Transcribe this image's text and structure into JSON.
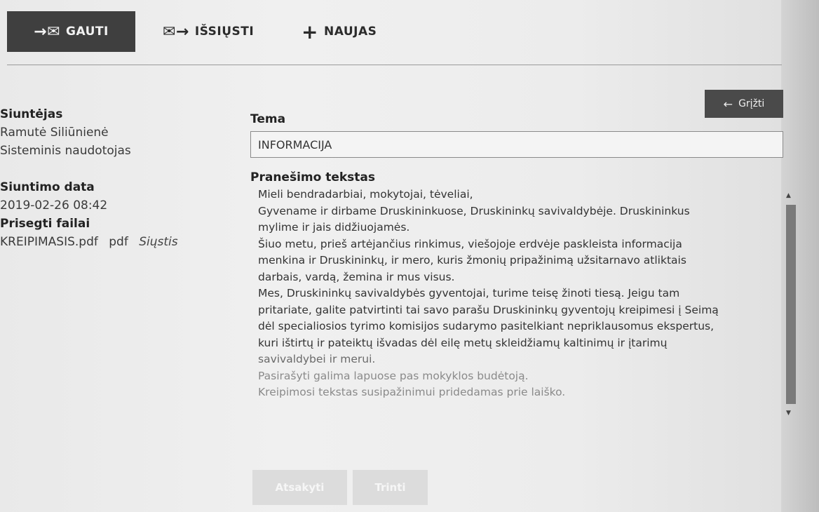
{
  "tabs": [
    {
      "icon": "→✉",
      "label": "GAUTI"
    },
    {
      "icon": "✉→",
      "label": "IŠSIŲSTI"
    },
    {
      "icon": "+",
      "label": "NAUJAS"
    }
  ],
  "sender": {
    "label": "Siuntėjas",
    "name": "Ramutė Siliūnienė",
    "role": "Sisteminis naudotojas"
  },
  "sent_date": {
    "label": "Siuntimo data",
    "value": "2019-02-26 08:42"
  },
  "attachments": {
    "label": "Prisegti failai",
    "filename": "KREIPIMASIS.pdf",
    "type": "pdf",
    "action": "Siųstis"
  },
  "back_button": {
    "label": "Grįžti",
    "icon": "arrow-left"
  },
  "subject": {
    "label": "Tema",
    "value": "INFORMACIJA"
  },
  "message": {
    "label": "Pranešimo tekstas",
    "lines": [
      "Mieli bendradarbiai, mokytojai, tėveliai,",
      "Gyvename ir dirbame Druskininkuose, Druskininkų savivaldybėje. Druskininkus",
      "mylime ir jais didžiuojamės.",
      "Šiuo metu, prieš artėjančius rinkimus, viešojoje erdvėje paskleista informacija",
      "menkina ir Druskininkų, ir mero, kuris žmonių pripažinimą užsitarnavo atliktais",
      "darbais, vardą, žemina ir mus visus.",
      "Mes, Druskininkų savivaldybės gyventojai, turime teisę žinoti tiesą. Jeigu tam",
      "pritariate, galite patvirtinti tai savo parašu Druskininkų gyventojų kreipimesi į Seimą",
      "dėl specialiosios tyrimo komisijos sudarymo pasitelkiant nepriklausomus ekspertus,",
      "kuri ištirtų ir pateiktų išvadas dėl eilę metų skleidžiamų kaltinimų ir įtarimų",
      "savivaldybei ir merui.",
      "Pasirašyti galima lapuose pas mokyklos budėtoją.",
      "Kreipimosi tekstas susipažinimui pridedamas prie laiško."
    ]
  },
  "actions": {
    "reply": "Atsakyti",
    "delete": "Trinti"
  }
}
